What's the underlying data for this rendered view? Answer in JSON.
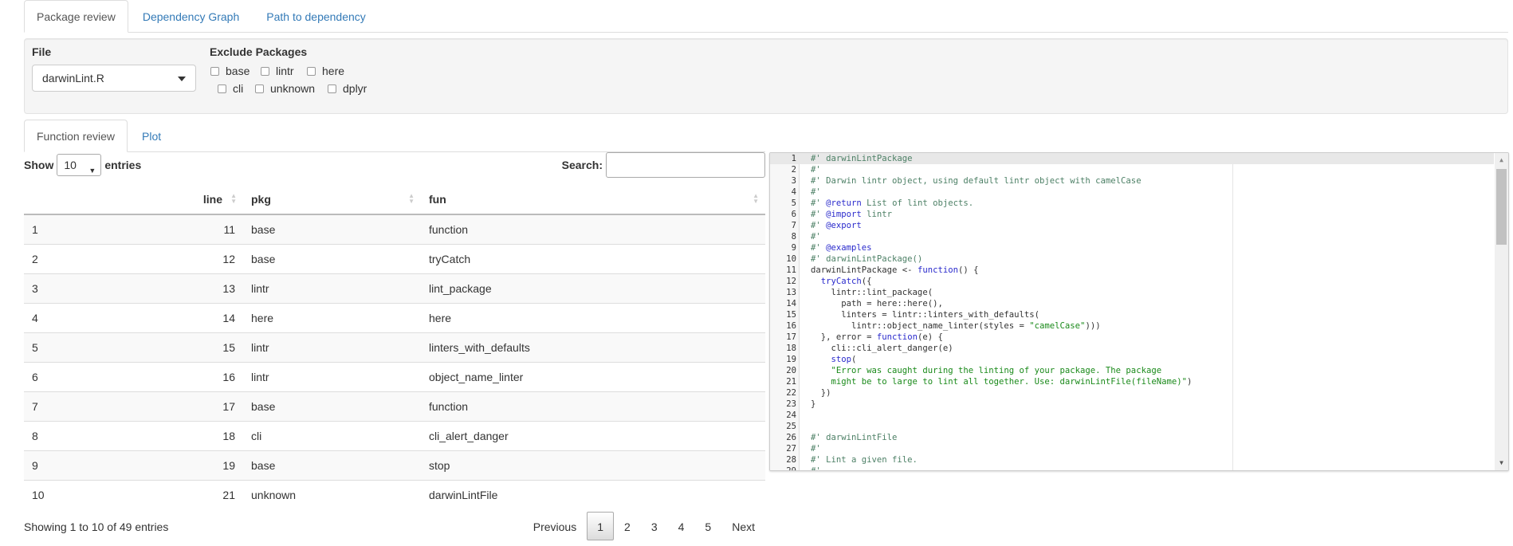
{
  "top_tabs": [
    {
      "label": "Package review",
      "active": true
    },
    {
      "label": "Dependency Graph",
      "active": false
    },
    {
      "label": "Path to dependency",
      "active": false
    }
  ],
  "filters": {
    "file_label": "File",
    "file_value": "darwinLint.R",
    "exclude_label": "Exclude Packages",
    "packages": [
      {
        "label": "base",
        "checked": false
      },
      {
        "label": "lintr",
        "checked": false
      },
      {
        "label": "here",
        "checked": false
      },
      {
        "label": "cli",
        "checked": false
      },
      {
        "label": "unknown",
        "checked": false
      },
      {
        "label": "dplyr",
        "checked": false
      }
    ]
  },
  "inner_tabs": [
    {
      "label": "Function review",
      "active": true
    },
    {
      "label": "Plot",
      "active": false
    }
  ],
  "datatable": {
    "show_label": "Show",
    "entries_label": "entries",
    "page_length": "10",
    "search_label": "Search:",
    "search_value": "",
    "columns": [
      "",
      "line",
      "pkg",
      "fun"
    ],
    "rows": [
      [
        "1",
        "11",
        "base",
        "function"
      ],
      [
        "2",
        "12",
        "base",
        "tryCatch"
      ],
      [
        "3",
        "13",
        "lintr",
        "lint_package"
      ],
      [
        "4",
        "14",
        "here",
        "here"
      ],
      [
        "5",
        "15",
        "lintr",
        "linters_with_defaults"
      ],
      [
        "6",
        "16",
        "lintr",
        "object_name_linter"
      ],
      [
        "7",
        "17",
        "base",
        "function"
      ],
      [
        "8",
        "18",
        "cli",
        "cli_alert_danger"
      ],
      [
        "9",
        "19",
        "base",
        "stop"
      ],
      [
        "10",
        "21",
        "unknown",
        "darwinLintFile"
      ]
    ],
    "info": "Showing 1 to 10 of 49 entries",
    "pagination": {
      "previous": "Previous",
      "pages": [
        "1",
        "2",
        "3",
        "4",
        "5"
      ],
      "current": "1",
      "next": "Next"
    }
  },
  "editor": {
    "lines": [
      [
        {
          "t": "#' darwinLintPackage",
          "c": "com"
        }
      ],
      [
        {
          "t": "#'",
          "c": "com"
        }
      ],
      [
        {
          "t": "#' Darwin lintr object, using default lintr object with camelCase",
          "c": "com"
        }
      ],
      [
        {
          "t": "#'",
          "c": "com"
        }
      ],
      [
        {
          "t": "#' ",
          "c": "com"
        },
        {
          "t": "@return",
          "c": "kw"
        },
        {
          "t": " List of lint objects.",
          "c": "com"
        }
      ],
      [
        {
          "t": "#' ",
          "c": "com"
        },
        {
          "t": "@import",
          "c": "kw"
        },
        {
          "t": " lintr",
          "c": "com"
        }
      ],
      [
        {
          "t": "#' ",
          "c": "com"
        },
        {
          "t": "@export",
          "c": "kw"
        }
      ],
      [
        {
          "t": "#'",
          "c": "com"
        }
      ],
      [
        {
          "t": "#' ",
          "c": "com"
        },
        {
          "t": "@examples",
          "c": "kw"
        }
      ],
      [
        {
          "t": "#' darwinLintPackage()",
          "c": "com"
        }
      ],
      [
        {
          "t": "darwinLintPackage <- ",
          "c": ""
        },
        {
          "t": "function",
          "c": "kw"
        },
        {
          "t": "() {",
          "c": ""
        }
      ],
      [
        {
          "t": "  ",
          "c": ""
        },
        {
          "t": "tryCatch",
          "c": "kw"
        },
        {
          "t": "({",
          "c": ""
        }
      ],
      [
        {
          "t": "    lintr::lint_package(",
          "c": ""
        }
      ],
      [
        {
          "t": "      path = here::here(),",
          "c": ""
        }
      ],
      [
        {
          "t": "      linters = lintr::linters_with_defaults(",
          "c": ""
        }
      ],
      [
        {
          "t": "        lintr::object_name_linter(styles = ",
          "c": ""
        },
        {
          "t": "\"camelCase\"",
          "c": "str"
        },
        {
          "t": ")))",
          "c": ""
        }
      ],
      [
        {
          "t": "  }, error = ",
          "c": ""
        },
        {
          "t": "function",
          "c": "kw"
        },
        {
          "t": "(e) {",
          "c": ""
        }
      ],
      [
        {
          "t": "    cli::cli_alert_danger(e)",
          "c": ""
        }
      ],
      [
        {
          "t": "    ",
          "c": ""
        },
        {
          "t": "stop",
          "c": "kw"
        },
        {
          "t": "(",
          "c": ""
        }
      ],
      [
        {
          "t": "    \"Error was caught during the linting of your package. The package",
          "c": "str"
        }
      ],
      [
        {
          "t": "    might be to large to lint all together. Use: darwinLintFile(fileName)\"",
          "c": "str"
        },
        {
          "t": ")",
          "c": ""
        }
      ],
      [
        {
          "t": "  })",
          "c": ""
        }
      ],
      [
        {
          "t": "}",
          "c": ""
        }
      ],
      [
        {
          "t": "",
          "c": ""
        }
      ],
      [
        {
          "t": "",
          "c": ""
        }
      ],
      [
        {
          "t": "#' darwinLintFile",
          "c": "com"
        }
      ],
      [
        {
          "t": "#'",
          "c": "com"
        }
      ],
      [
        {
          "t": "#' Lint a given file.",
          "c": "com"
        }
      ],
      [
        {
          "t": "#'",
          "c": "com"
        }
      ]
    ],
    "active_line": 1,
    "scroll_position": 0.0
  }
}
